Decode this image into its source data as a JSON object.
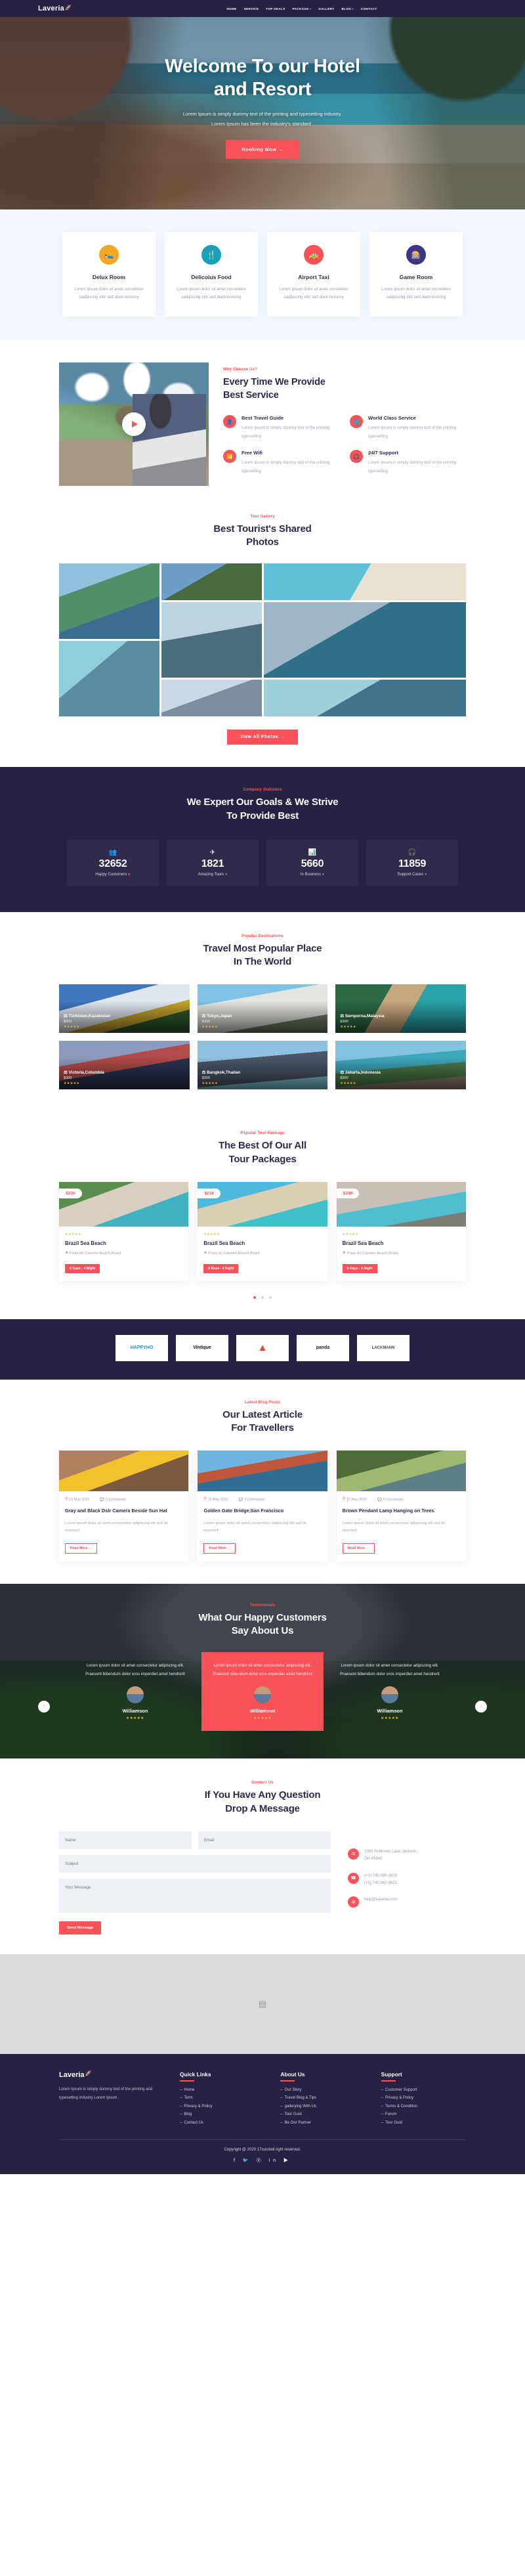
{
  "brand": {
    "name": "Laveria",
    "icon": "rocket-icon"
  },
  "nav": {
    "items": [
      {
        "label": "HOME",
        "caret": ""
      },
      {
        "label": "SERVICE",
        "caret": ""
      },
      {
        "label": "TOP DEALS",
        "caret": ""
      },
      {
        "label": "PACKAGE",
        "caret": "˅"
      },
      {
        "label": "GALLERY",
        "caret": ""
      },
      {
        "label": "BLOG",
        "caret": "˅"
      },
      {
        "label": "CONTACT",
        "caret": ""
      }
    ]
  },
  "hero": {
    "title_line1": "Welcome To our Hotel",
    "title_line2": "and Resort",
    "desc_line1": "Lorem Ipsum is simply dummy text of the printing and typesetting industry.",
    "desc_line2": "Lorem Ipsum has been the industry's standard .",
    "cta": "Booking Now  →"
  },
  "features": {
    "cards": [
      {
        "title": "Delux Room",
        "icon": "bed-icon",
        "color": "#f5a623",
        "glyph": "🛏",
        "text": "Lorem ipsum dolor sit amet consetetur sadipscing elitr sed diam nonumy"
      },
      {
        "title": "Delicoius Food",
        "icon": "food-icon",
        "color": "#17a2b8",
        "glyph": "🍴",
        "text": "Lorem ipsum dolor sit amet consetetur sadipscing elitr sed diam nonumy"
      },
      {
        "title": "Airport Taxi",
        "icon": "taxi-icon",
        "color": "#fa5258",
        "glyph": "🚕",
        "text": "Lorem ipsum dolor sit amet consetetur sadipscing elitr sed diam nonumy"
      },
      {
        "title": "Game Room",
        "icon": "game-icon",
        "color": "#3b3687",
        "glyph": "🎰",
        "text": "Lorem ipsum dolor sit amet consetetur sadipscing elitr sed diam nonumy"
      }
    ]
  },
  "why": {
    "sub": "Why Choose Us?",
    "title_line1": "Every Time We Provide",
    "title_line2": "Best Service",
    "play": "play-icon",
    "items": [
      {
        "title": "Best Travel Guide",
        "glyph": "👤",
        "text": "Lorem Ipsum is simply dummy text of the printing typesetting"
      },
      {
        "title": "World Class Service",
        "glyph": "🌐",
        "text": "Lorem Ipsum is simply dummy text of the printing typesetting"
      },
      {
        "title": "Free Wifi",
        "glyph": "📶",
        "text": "Lorem Ipsum is simply dummy text of the printing typesetting"
      },
      {
        "title": "24/7 Support",
        "glyph": "🎧",
        "text": "Lorem Ipsum is simply dummy text of the printing typesetting"
      }
    ]
  },
  "gallery": {
    "sub": "Tour Gallery",
    "title_line1": "Best Tourist's Shared",
    "title_line2": "Photos",
    "cta": "View All Photos  →"
  },
  "stats": {
    "sub": "Company Statistics",
    "title_line1": "We Expert Our Goals & We Strive",
    "title_line2": "To Provide Best",
    "cards": [
      {
        "value": "32652",
        "label": "Happy Customers",
        "glyph": "👥",
        "icon": "people-icon"
      },
      {
        "value": "1821",
        "label": "Amazing Tours",
        "glyph": "✈",
        "icon": "plane-icon"
      },
      {
        "value": "5660",
        "label": "In Business",
        "glyph": "📊",
        "icon": "chart-icon"
      },
      {
        "value": "11859",
        "label": "Support Cases",
        "glyph": "🎧",
        "icon": "headset-icon"
      }
    ]
  },
  "places": {
    "sub": "Popular Destinations",
    "title_line1": "Travel Most Popular Place",
    "title_line2": "In The World",
    "cards": [
      {
        "name": "Türkistan,Kazakistan",
        "price": "$300",
        "stars": "★★★★★"
      },
      {
        "name": "Tokyo,Japan",
        "price": "$300",
        "stars": "★★★★★"
      },
      {
        "name": "Semporna,Malaysia",
        "price": "$300",
        "stars": "★★★★★"
      },
      {
        "name": "Victoria,Columbia",
        "price": "$300",
        "stars": "★★★★★"
      },
      {
        "name": "Bangkok,Thailan",
        "price": "$300",
        "stars": "★★★★★"
      },
      {
        "name": "Jakarta,Indonesia",
        "price": "$300",
        "stars": "★★★★★"
      }
    ]
  },
  "packages": {
    "sub": "Popular Tour Package",
    "title_line1": "The Best Of Our All",
    "title_line2": "Tour Packages",
    "cards": [
      {
        "price": "$236",
        "stars": "★★★★★",
        "title": "Brazil Sea Beach",
        "loc": "⚑ Praia do Cassino Beach,Brazil",
        "pill": "5 Days - 4 Night"
      },
      {
        "price": "$236",
        "stars": "★★★★★",
        "title": "Brazil Sea Beach",
        "loc": "⚑ Praia do Cassino Beach,Brazil",
        "pill": "5 Days - 4 Night"
      },
      {
        "price": "$236",
        "stars": "★★★★★",
        "title": "Brazil Sea Beach",
        "loc": "⚑ Praia do Cassino Beach,Brazil",
        "pill": "5 Days - 4 Night"
      }
    ]
  },
  "brands": {
    "logos": [
      {
        "label": "HAPPYHO"
      },
      {
        "label": "Vintique"
      },
      {
        "label": "▲"
      },
      {
        "label": "panda"
      },
      {
        "label": "LACKMANN"
      }
    ]
  },
  "blog": {
    "sub": "Latest Blog Posts",
    "title_line1": "Our Latest Article",
    "title_line2": "For Travellers",
    "posts": [
      {
        "date": "15 May 2020",
        "comments": "0 Comments",
        "title": "Gray and Black Dslr Camera Beside Sun Hat",
        "excerpt": "Lorem ipsum dolor sit amet,consectetur adipiscing elit sed do eiusmod",
        "cta": "Read More →"
      },
      {
        "date": "15 May 2020",
        "comments": "0 Comments",
        "title": "Golden Gate Bridge,San Francisco",
        "excerpt": "Lorem ipsum dolor sit amet,consectetur adipiscing elit sed do eiusmod",
        "cta": "Read More →"
      },
      {
        "date": "15 May 2020",
        "comments": "0 Comments",
        "title": "Brown Pendant Lamp Hanging on Trees",
        "excerpt": "Lorem ipsum dolor sit amet,consectetur adipiscing elit sed do eiusmod",
        "cta": "Read More →"
      }
    ]
  },
  "testimonials": {
    "sub": "Testimonials",
    "title_line1": "What Our Happy Customers",
    "title_line2": "Say About Us",
    "prev": "‹",
    "next": "›",
    "cards": [
      {
        "quote": "Lorem ipsum dolor sit amet consectetur adipiscing elit. Praesent bibendum dolor eros imperdiet amet hendrerit",
        "name": "Williamson",
        "stars": "★★★★★"
      },
      {
        "quote": "Lorem ipsum dolor sit amet consectetur adipiscing elit. Praesent bibendum dolor eros imperdiet amet hendrerit",
        "name": "Williamson",
        "stars": "★★★★★"
      },
      {
        "quote": "Lorem ipsum dolor sit amet consectetur adipiscing elit. Praesent bibendum dolor eros imperdiet amet hendrerit",
        "name": "Williamson",
        "stars": "★★★★★"
      }
    ]
  },
  "contact": {
    "sub": "Contact Us",
    "title_line1": "If You Have Any Question",
    "title_line2": "Drop A Message",
    "name_ph": "Name",
    "email_ph": "Email",
    "subject_ph": "Subject",
    "message_ph": "Your Message",
    "send": "Send Message",
    "info": [
      {
        "glyph": "⚑",
        "icon": "location-icon",
        "line1": "2369 Robinson Lane Jackson",
        "line2": "OH 45640"
      },
      {
        "glyph": "☎",
        "icon": "phone-icon",
        "line1": "(+1) 740-395-3829",
        "line2": "(+1) 740-982-9821"
      },
      {
        "glyph": "✉",
        "icon": "mail-icon",
        "line1": "help@Laveria.com",
        "line2": ""
      }
    ]
  },
  "map": {
    "icon": "map-pin-icon",
    "glyph": "▤"
  },
  "footer": {
    "brand": "Laveria",
    "about": "Lorem Ipsum is simply dummy text of the printing and typesetting industry Lorem Ipsum .",
    "columns": [
      {
        "heading": "Quick Links",
        "links": [
          "Home",
          "Term",
          "Privacy & Policy",
          "Blog",
          "Contact Us"
        ]
      },
      {
        "heading": "About Us",
        "links": [
          "Our Story",
          "Travel Blog & Tips",
          "gallerying With Us",
          "Tour Guid",
          "Be Our Partner"
        ]
      },
      {
        "heading": "Support",
        "links": [
          "Customer Support",
          "Privacy & Policy",
          "Terms & Condition",
          "Forum",
          "Tour Guid"
        ]
      }
    ],
    "copyright": "Copyright @ 2020 17sucolall right reserved.",
    "socials": "f 🐦 ⓟ in ▶"
  },
  "colors": {
    "accent": "#fa5258",
    "dark": "#272243",
    "star": "#f7b731"
  }
}
